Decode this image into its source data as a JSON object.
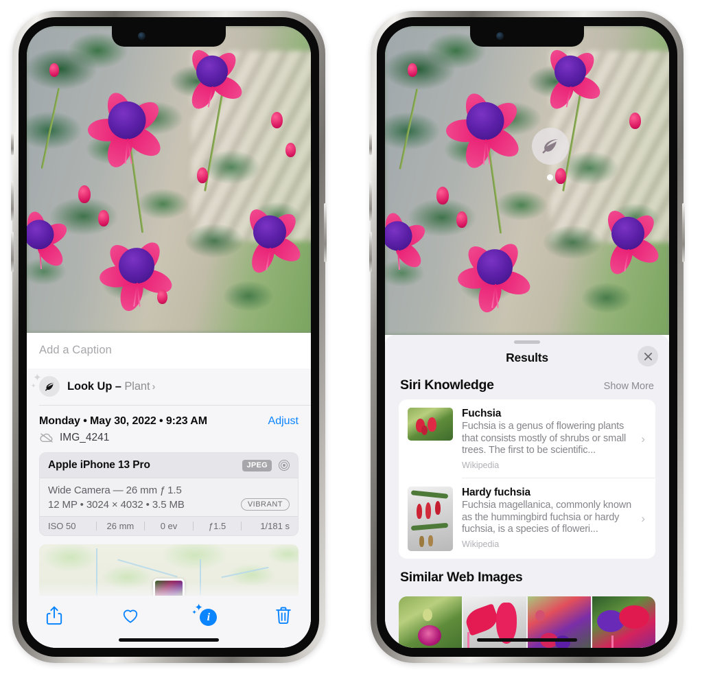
{
  "left_phone": {
    "name": "photos-info-screen",
    "caption": {
      "placeholder": "Add a Caption",
      "value": ""
    },
    "look_up": {
      "label": "Look Up",
      "dash": " – ",
      "subject": "Plant",
      "chevron": "›"
    },
    "photo_meta": {
      "datetime": "Monday • May 30, 2022 • 9:23 AM",
      "adjust_label": "Adjust",
      "filename": "IMG_4241"
    },
    "device_card": {
      "device": "Apple iPhone 13 Pro",
      "format_badge": "JPEG",
      "lens_line": "Wide Camera — 26 mm ƒ 1.5",
      "size_line": "12 MP • 3024 × 4032 • 3.5 MB",
      "style_badge": "VIBRANT",
      "exif": [
        "ISO 50",
        "26 mm",
        "0 ev",
        "ƒ1.5",
        "1/181 s"
      ]
    },
    "toolbar": {
      "share_label": "Share",
      "favorite_label": "Favorite",
      "info_label": "Info",
      "delete_label": "Delete"
    }
  },
  "right_phone": {
    "name": "visual-look-up-results",
    "badge": {
      "icon": "leaf-icon"
    },
    "sheet": {
      "title": "Results",
      "close_label": "Close"
    },
    "siri_knowledge": {
      "title": "Siri Knowledge",
      "action": "Show More",
      "items": [
        {
          "title": "Fuchsia",
          "description": "Fuchsia is a genus of flowering plants that consists mostly of shrubs or small trees. The first to be scientific...",
          "source": "Wikipedia",
          "chevron": "›"
        },
        {
          "title": "Hardy fuchsia",
          "description": "Fuchsia magellanica, commonly known as the hummingbird fuchsia or hardy fuchsia, is a species of floweri...",
          "source": "Wikipedia",
          "chevron": "›"
        }
      ]
    },
    "similar_web_images": {
      "title": "Similar Web Images",
      "count": 4
    }
  },
  "colors": {
    "accent_blue": "#0a84ff",
    "sheet_bg": "#f6f6f8",
    "results_bg": "#f1f0f4",
    "card_bg": "#ffffff",
    "secondary_text": "#8e8e93"
  }
}
